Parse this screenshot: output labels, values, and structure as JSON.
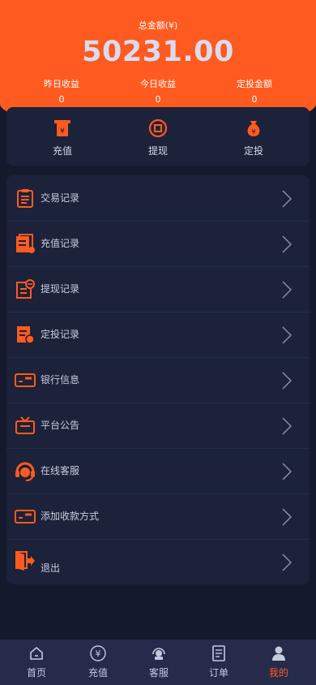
{
  "header": {
    "total_label": "总金额(¥)",
    "total_value": "50231.00",
    "stats": [
      {
        "label": "昨日收益",
        "value": "0"
      },
      {
        "label": "今日收益",
        "value": "0"
      },
      {
        "label": "定投金额",
        "value": "0"
      }
    ]
  },
  "actions": [
    {
      "label": "充值",
      "icon": "atm-yuan-icon"
    },
    {
      "label": "提现",
      "icon": "withdraw-coin-icon"
    },
    {
      "label": "定投",
      "icon": "money-bag-icon"
    }
  ],
  "menu": [
    {
      "label": "交易记录",
      "icon": "clipboard-icon"
    },
    {
      "label": "充值记录",
      "icon": "recharge-doc-icon"
    },
    {
      "label": "提现记录",
      "icon": "withdraw-doc-icon"
    },
    {
      "label": "定投记录",
      "icon": "invest-doc-icon"
    },
    {
      "label": "银行信息",
      "icon": "bank-card-icon"
    },
    {
      "label": "平台公告",
      "icon": "announcement-icon"
    },
    {
      "label": "在线客服",
      "icon": "headset-icon"
    },
    {
      "label": "添加收款方式",
      "icon": "add-card-icon"
    },
    {
      "label": "退出",
      "icon": "logout-icon"
    }
  ],
  "tabbar": [
    {
      "label": "首页",
      "icon": "home-icon"
    },
    {
      "label": "充值",
      "icon": "yuan-circle-icon"
    },
    {
      "label": "客服",
      "icon": "support-icon"
    },
    {
      "label": "订单",
      "icon": "order-icon"
    },
    {
      "label": "我的",
      "icon": "user-icon",
      "active": true
    }
  ],
  "colors": {
    "accent": "#ff5a1f",
    "background": "#141a2c",
    "card": "#1c2239",
    "tabbar": "#262b4a"
  }
}
